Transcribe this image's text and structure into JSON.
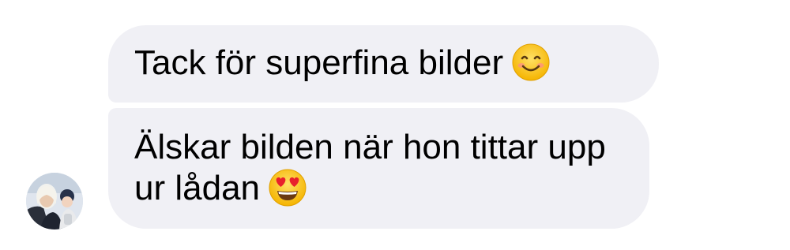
{
  "conversation": {
    "messages": [
      {
        "text": "Tack för superfina bilder",
        "emoji": "smiling-face-icon"
      },
      {
        "text": "Älskar bilden när hon tittar upp ur lådan",
        "emoji": "heart-eyes-face-icon"
      }
    ],
    "bubble_color": "#f0f0f5",
    "text_color": "#000000"
  },
  "sender": {
    "avatar": "avatar-photo"
  }
}
